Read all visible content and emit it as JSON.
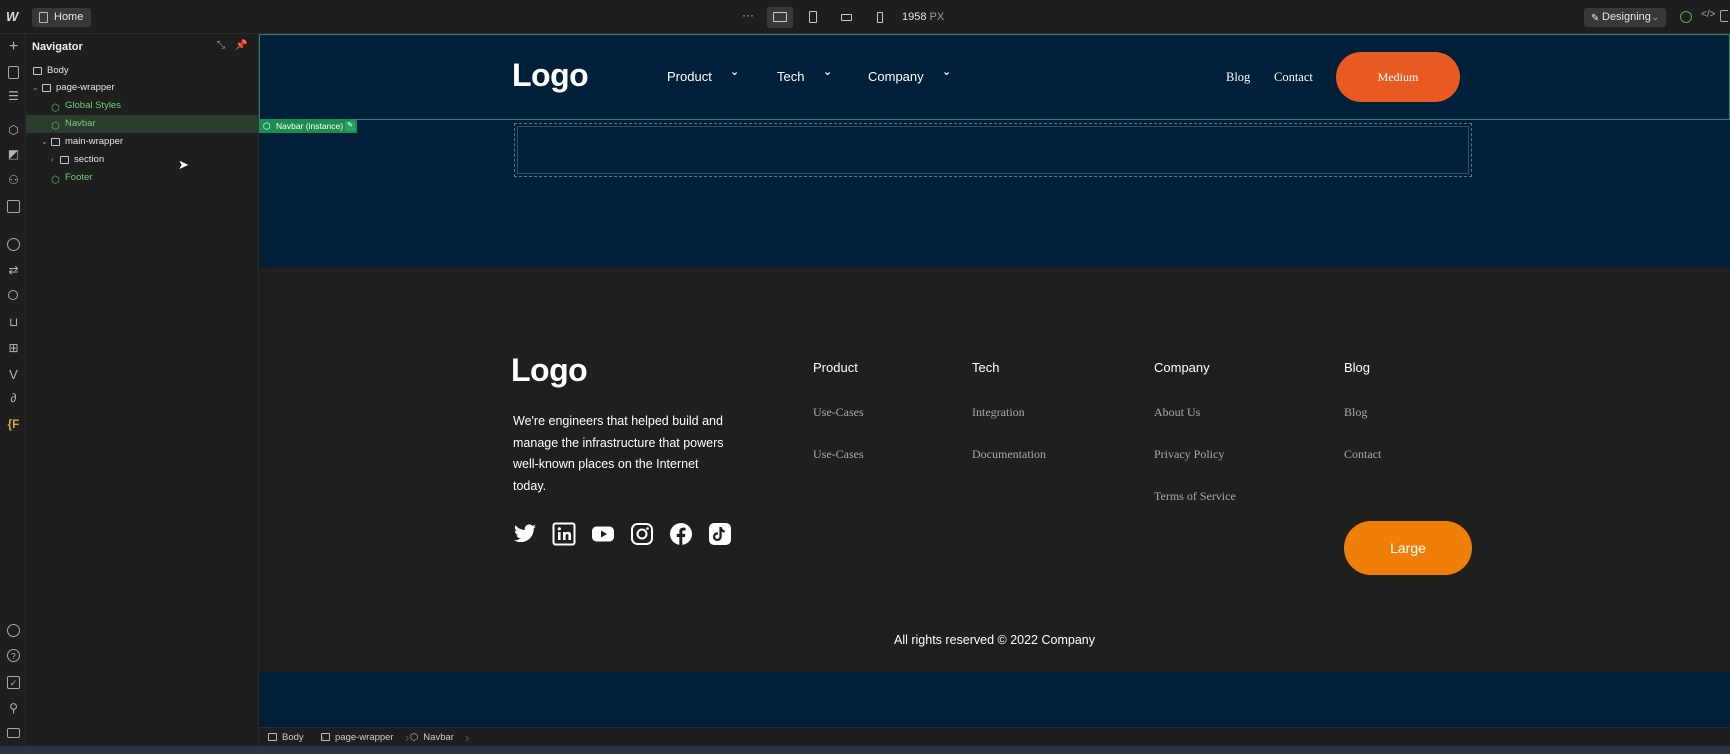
{
  "topbar": {
    "page_name": "Home",
    "more": "···",
    "width_value": "1958",
    "width_unit": "PX",
    "mode": "Designing"
  },
  "navigator": {
    "title": "Navigator",
    "tree": [
      {
        "label": "Body"
      },
      {
        "label": "page-wrapper"
      },
      {
        "label": "Global Styles"
      },
      {
        "label": "Navbar"
      },
      {
        "label": "main-wrapper"
      },
      {
        "label": "section"
      },
      {
        "label": "Footer"
      }
    ]
  },
  "canvas": {
    "selection_tag": "Navbar (instance)",
    "navbar": {
      "logo": "Logo",
      "menu": [
        "Product",
        "Tech",
        "Company"
      ],
      "links": [
        "Blog",
        "Contact"
      ],
      "cta": "Medium",
      "cta_color": "#e85a22"
    },
    "footer": {
      "logo": "Logo",
      "description": "We're engineers that helped build and manage the infrastructure that powers well-known places on the Internet today.",
      "socials": [
        "twitter-icon",
        "linkedin-icon",
        "youtube-icon",
        "instagram-icon",
        "facebook-icon",
        "tiktok-icon"
      ],
      "columns": [
        {
          "title": "Product",
          "links": [
            "Use-Cases",
            "Use-Cases"
          ]
        },
        {
          "title": "Tech",
          "links": [
            "Integration",
            "Documentation"
          ]
        },
        {
          "title": "Company",
          "links": [
            "About Us",
            "Privacy Policy",
            "Terms of Service"
          ]
        },
        {
          "title": "Blog",
          "links": [
            "Blog",
            "Contact"
          ]
        }
      ],
      "cta": "Large",
      "cta_color": "#f07f0a",
      "copyright": "All rights reserved © 2022 Company"
    }
  },
  "breadcrumb": [
    "Body",
    "page-wrapper",
    "Navbar"
  ]
}
